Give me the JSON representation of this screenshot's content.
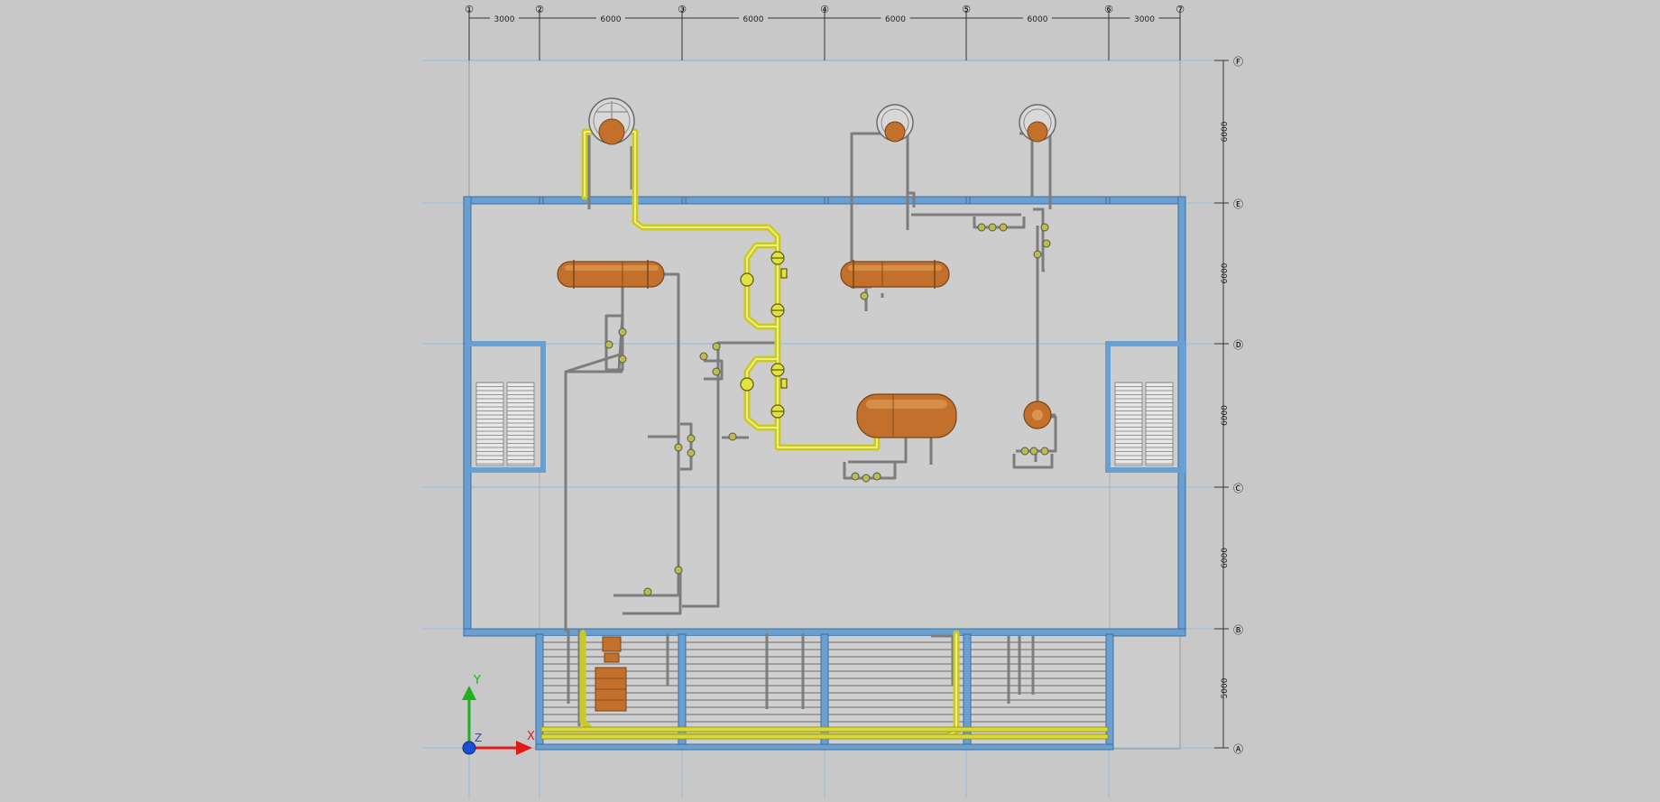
{
  "colors": {
    "background": "#c8c8c8",
    "slab": "#cfcfcf",
    "wall": "#6a9fd1",
    "wall_dark": "#4f7fae",
    "pipe_gray": "#7d7d7d",
    "pipe_yellow": "#d8d836",
    "vessel": "#c2702c",
    "grid_line": "#8fb7e2",
    "axis_x": "#e21a1a",
    "axis_y": "#1db11d",
    "axis_origin": "#1a4fd0"
  },
  "grid": {
    "columns": [
      {
        "id": "col-1",
        "label": "①"
      },
      {
        "id": "col-2",
        "label": "②"
      },
      {
        "id": "col-3",
        "label": "③"
      },
      {
        "id": "col-4",
        "label": "④"
      },
      {
        "id": "col-5",
        "label": "⑤"
      },
      {
        "id": "col-6",
        "label": "⑥"
      },
      {
        "id": "col-7",
        "label": "⑦"
      }
    ],
    "column_spacings": [
      "3000",
      "6000",
      "6000",
      "6000",
      "6000",
      "3000"
    ],
    "rows": [
      {
        "id": "row-F",
        "label": "Ⓕ"
      },
      {
        "id": "row-E",
        "label": "Ⓔ"
      },
      {
        "id": "row-D",
        "label": "Ⓓ"
      },
      {
        "id": "row-C",
        "label": "Ⓒ"
      },
      {
        "id": "row-B",
        "label": "Ⓑ"
      },
      {
        "id": "row-A",
        "label": "Ⓐ"
      }
    ],
    "row_spacings": [
      "6000",
      "6000",
      "6000",
      "6000",
      "5000"
    ]
  },
  "ucs": {
    "x_label": "X",
    "y_label": "Y",
    "z_label": "Z"
  },
  "icons": {
    "ucs": "ucs-axis-icon"
  }
}
